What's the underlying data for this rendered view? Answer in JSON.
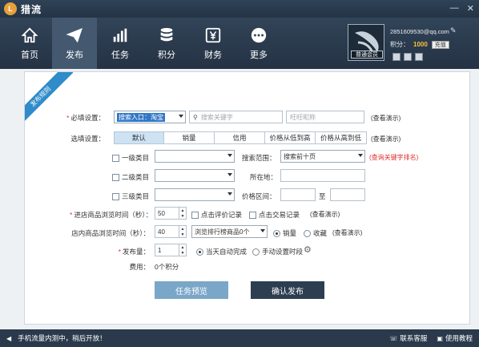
{
  "titlebar": {
    "app_name": "猎流",
    "logo_char": "L",
    "min": "—",
    "close": "✕"
  },
  "nav": {
    "items": [
      {
        "label": "首页",
        "icon": "home-icon"
      },
      {
        "label": "发布",
        "icon": "paper-plane-icon"
      },
      {
        "label": "任务",
        "icon": "bar-chart-icon"
      },
      {
        "label": "积分",
        "icon": "database-icon"
      },
      {
        "label": "财务",
        "icon": "yen-icon"
      },
      {
        "label": "更多",
        "icon": "more-icon"
      }
    ],
    "active": "发布"
  },
  "user": {
    "email": "2851609530@qq.com",
    "points_label": "积分：",
    "points_value": "1000",
    "recharge_label": "充值",
    "member_badge": "普通会员"
  },
  "form": {
    "ribbon": "发布规则",
    "required_label": "必填设置：",
    "search_entry_value": "搜索入口：淘宝",
    "keyword_placeholder": "搜索关键字",
    "wangwang_placeholder": "旺旺昵称",
    "view_demo": "(查看演示)",
    "optional_label": "选填设置：",
    "sort_tabs": [
      "默认",
      "销量",
      "信用",
      "价格从低到高",
      "价格从高到低"
    ],
    "category1_label": "一级类目",
    "category2_label": "二级类目",
    "category3_label": "三级类目",
    "search_range_label": "搜索范围：",
    "search_range_value": "搜索前十页",
    "keyword_rank_link": "(查询关键字排名)",
    "location_label": "所在地：",
    "price_range_label": "价格区间：",
    "price_to": "至",
    "shop_browse_label": "进店商品浏览时间（秒）：",
    "shop_browse_value": "50",
    "click_review": "点击评价记录",
    "click_trade": "点击交易记录",
    "view_demo2": "(查看演示)",
    "in_shop_browse_label": "店内商品浏览时间（秒）：",
    "in_shop_browse_value": "40",
    "rank_select": "浏览排行榜商品0个",
    "sales_label": "销量",
    "favorite_label": "收藏",
    "view_demo3": "(查看演示)",
    "publish_count_label": "发布量：",
    "publish_count_value": "1",
    "auto_complete": "当天自动完成",
    "manual_time": "手动设置时段",
    "cost_label": "费用：",
    "cost_value": "0个积分",
    "preview_btn": "任务预览",
    "confirm_btn": "确认发布"
  },
  "status": {
    "message": "手机流量内测中，稍后开放！",
    "contact": "联系客服",
    "tutorial": "使用教程"
  }
}
